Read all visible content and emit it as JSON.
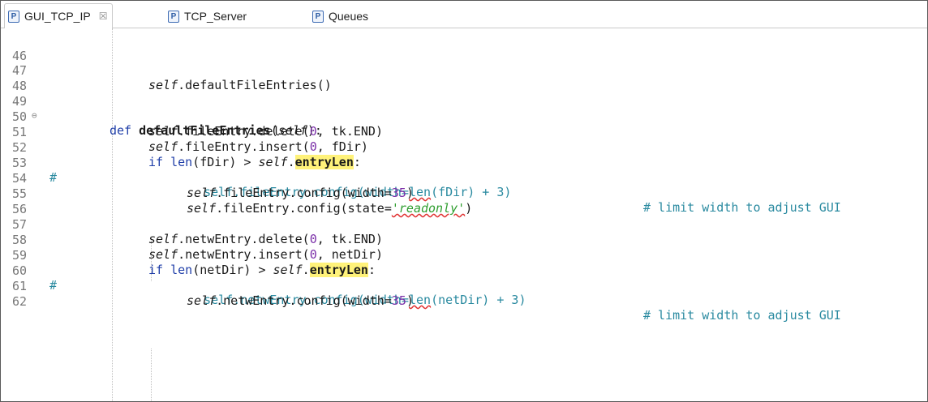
{
  "tabs": [
    {
      "label": "GUI_TCP_IP",
      "icon": "python-module-icon",
      "active": true
    },
    {
      "label": "TCP_Server",
      "icon": "python-module-icon",
      "active": false
    },
    {
      "label": "Queues",
      "icon": "python-module-icon",
      "active": false
    }
  ],
  "tab_close_glyph": "☒",
  "tab_icon_letter": "P",
  "fold_glyph": "⊖",
  "comment_marker": "#",
  "line_numbers": [
    "46",
    "47",
    "48",
    "49",
    "50",
    "51",
    "52",
    "53",
    "54",
    "55",
    "56",
    "57",
    "58",
    "59",
    "60",
    "61",
    "62"
  ],
  "colors": {
    "keyword": "#1f3ea8",
    "number": "#7a2ea8",
    "string": "#2f9e2f",
    "comment": "#2a8aa0",
    "highlight": "#fff27a",
    "spellcheck": "#e03030"
  },
  "code": {
    "l47": [
      "self",
      ".defaultFileEntries()"
    ],
    "l49": [
      "def",
      " ",
      "defaultFileEntries",
      "(",
      "self",
      "):"
    ],
    "l50": [
      "self",
      ".fileEntry.delete(",
      "0",
      ", tk.END)"
    ],
    "l51": [
      "self",
      ".fileEntry.insert(",
      "0",
      ", fDir)"
    ],
    "l52": [
      "if",
      " ",
      "len",
      "(fDir) > ",
      "self",
      ".",
      "entryLen",
      ":"
    ],
    "l53": [
      "    self.fileEntry.config(width=",
      "len",
      "(fDir) + 3)"
    ],
    "l54": [
      "self",
      ".fileEntry.config(width=",
      "35",
      ")",
      "# limit width to adjust GUI"
    ],
    "l55": [
      "self",
      ".fileEntry.config(state=",
      "'readonly'",
      ")"
    ],
    "l57": [
      "self",
      ".netwEntry.delete(",
      "0",
      ", tk.END)"
    ],
    "l58": [
      "self",
      ".netwEntry.insert(",
      "0",
      ", netDir)"
    ],
    "l59": [
      "if",
      " ",
      "len",
      "(netDir) > ",
      "self",
      ".",
      "entryLen",
      ":"
    ],
    "l60": [
      "    self.netwEntry.config(width=",
      "len",
      "(netDir) + 3)"
    ],
    "l61": [
      "self",
      ".netwEntry.config(width=",
      "35",
      ")",
      "# limit width to adjust GUI"
    ]
  }
}
